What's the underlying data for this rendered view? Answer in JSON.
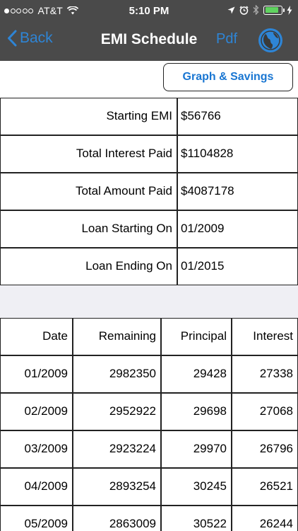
{
  "status_bar": {
    "carrier": "AT&T",
    "time": "5:10 PM"
  },
  "nav": {
    "back_label": "Back",
    "title": "EMI Schedule",
    "pdf_label": "Pdf",
    "accent_color": "#2e85d6"
  },
  "actions": {
    "graph_label": "Graph & Savings"
  },
  "summary": [
    {
      "label": "Starting EMI",
      "value": "$56766"
    },
    {
      "label": "Total Interest Paid",
      "value": "$1104828"
    },
    {
      "label": "Total Amount Paid",
      "value": "$4087178"
    },
    {
      "label": "Loan Starting On",
      "value": "01/2009"
    },
    {
      "label": "Loan Ending On",
      "value": "01/2015"
    }
  ],
  "schedule": {
    "headers": [
      "Date",
      "Remaining",
      "Principal",
      "Interest"
    ],
    "rows": [
      [
        "01/2009",
        "2982350",
        "29428",
        "27338"
      ],
      [
        "02/2009",
        "2952922",
        "29698",
        "27068"
      ],
      [
        "03/2009",
        "2923224",
        "29970",
        "26796"
      ],
      [
        "04/2009",
        "2893254",
        "30245",
        "26521"
      ],
      [
        "05/2009",
        "2863009",
        "30522",
        "26244"
      ]
    ]
  },
  "icons": {
    "wifi": "wifi-icon",
    "location": "location-arrow-icon",
    "alarm": "alarm-clock-icon",
    "bluetooth": "bluetooth-icon",
    "battery": "battery-icon",
    "charging": "charging-bolt-icon",
    "back": "chevron-left-icon",
    "globe": "globe-icon"
  }
}
